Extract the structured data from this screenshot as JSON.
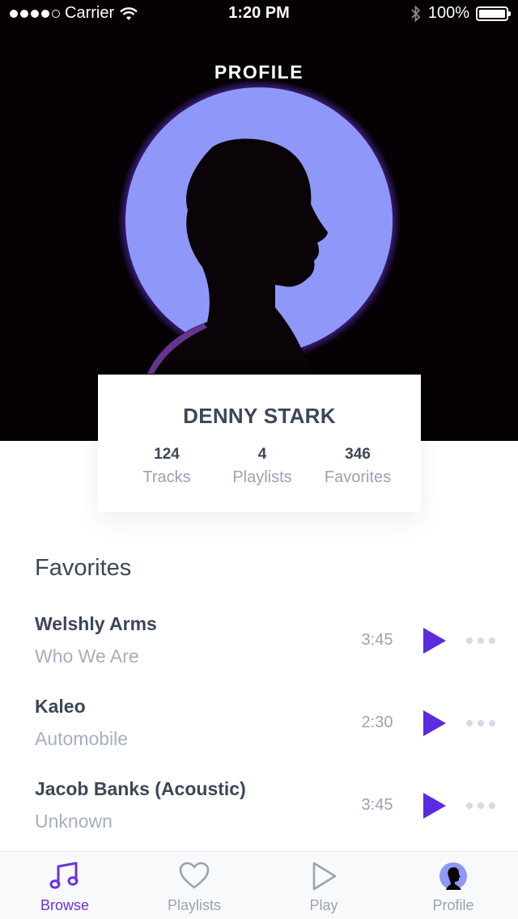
{
  "status_bar": {
    "carrier": "Carrier",
    "time": "1:20 PM",
    "battery": "100%"
  },
  "header": {
    "title": "PROFILE"
  },
  "profile": {
    "name": "DENNY STARK",
    "stats": [
      {
        "value": "124",
        "label": "Tracks"
      },
      {
        "value": "4",
        "label": "Playlists"
      },
      {
        "value": "346",
        "label": "Favorites"
      }
    ]
  },
  "favorites": {
    "title": "Favorites",
    "tracks": [
      {
        "title": "Welshly Arms",
        "subtitle": "Who We Are",
        "duration": "3:45"
      },
      {
        "title": "Kaleo",
        "subtitle": "Automobile",
        "duration": "2:30"
      },
      {
        "title": "Jacob Banks (Acoustic)",
        "subtitle": "Unknown",
        "duration": "3:45"
      }
    ]
  },
  "tab_bar": {
    "items": [
      {
        "label": "Browse",
        "icon": "music-note-icon",
        "active": true
      },
      {
        "label": "Playlists",
        "icon": "heart-icon",
        "active": false
      },
      {
        "label": "Play",
        "icon": "play-icon",
        "active": false
      },
      {
        "label": "Profile",
        "icon": "avatar-icon",
        "active": false
      }
    ]
  },
  "colors": {
    "accent": "#5a2be0",
    "hero_background": "#050104",
    "avatar_circle": "#8f98f8",
    "text_primary": "#3c4757",
    "text_secondary": "#9aa3b3"
  }
}
